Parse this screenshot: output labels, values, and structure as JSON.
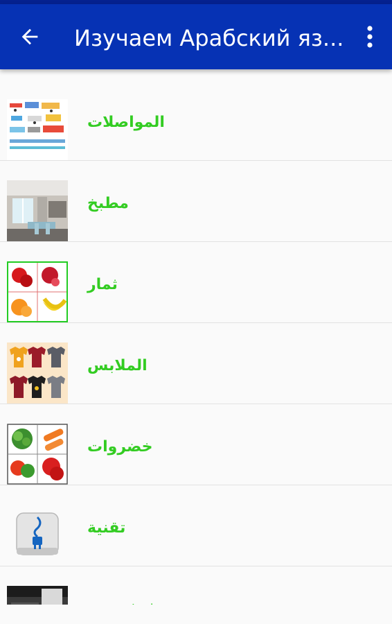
{
  "app_bar": {
    "title": "Изучаем Арабский яз...",
    "back_icon": "arrow-back-icon",
    "menu_icon": "more-vert-icon",
    "background": "#0632b4"
  },
  "categories": [
    {
      "label": "المواصلات",
      "thumbnail": "transport-icon"
    },
    {
      "label": "مطبخ",
      "thumbnail": "kitchen-photo"
    },
    {
      "label": "ثمار",
      "thumbnail": "fruits-icon"
    },
    {
      "label": "الملابس",
      "thumbnail": "clothes-icon"
    },
    {
      "label": "خضروات",
      "thumbnail": "vegetables-icon"
    },
    {
      "label": "تقنية",
      "thumbnail": "plug-icon"
    },
    {
      "label": "غرفة نوم",
      "thumbnail": "bedroom-photo"
    }
  ],
  "label_color": "#33cc22"
}
